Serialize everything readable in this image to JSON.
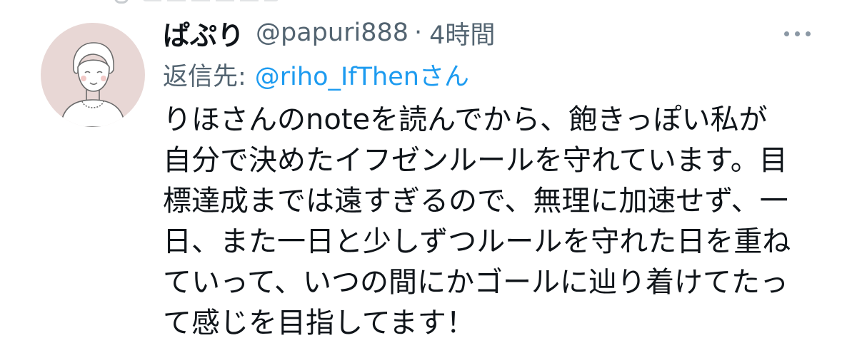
{
  "tweet": {
    "display_name": "ぱぷり",
    "handle": "@papuri888",
    "separator": "·",
    "time": "4時間",
    "reply_prefix": "返信先:",
    "reply_to": "@riho_IfThenさん",
    "body_lines": [
      "りほさんのnoteを読んでから、飽きっぽい私が",
      "自分で決めたイフゼンルールを守れています。目",
      "標達成までは遠すぎるので、無理に加速せず、一",
      "日、また一日と少しずつルールを守れた日を重ね",
      "ていって、いつの間にかゴールに辿り着けてたっ",
      "て感じを目指してます！"
    ]
  },
  "icons": {
    "more": "more-horizontal-icon",
    "avatar": "user-avatar-illustration"
  },
  "colors": {
    "name": "#0f1419",
    "muted": "#536471",
    "link": "#1d9bf0",
    "avatar_bg": "#e8d7d5"
  }
}
